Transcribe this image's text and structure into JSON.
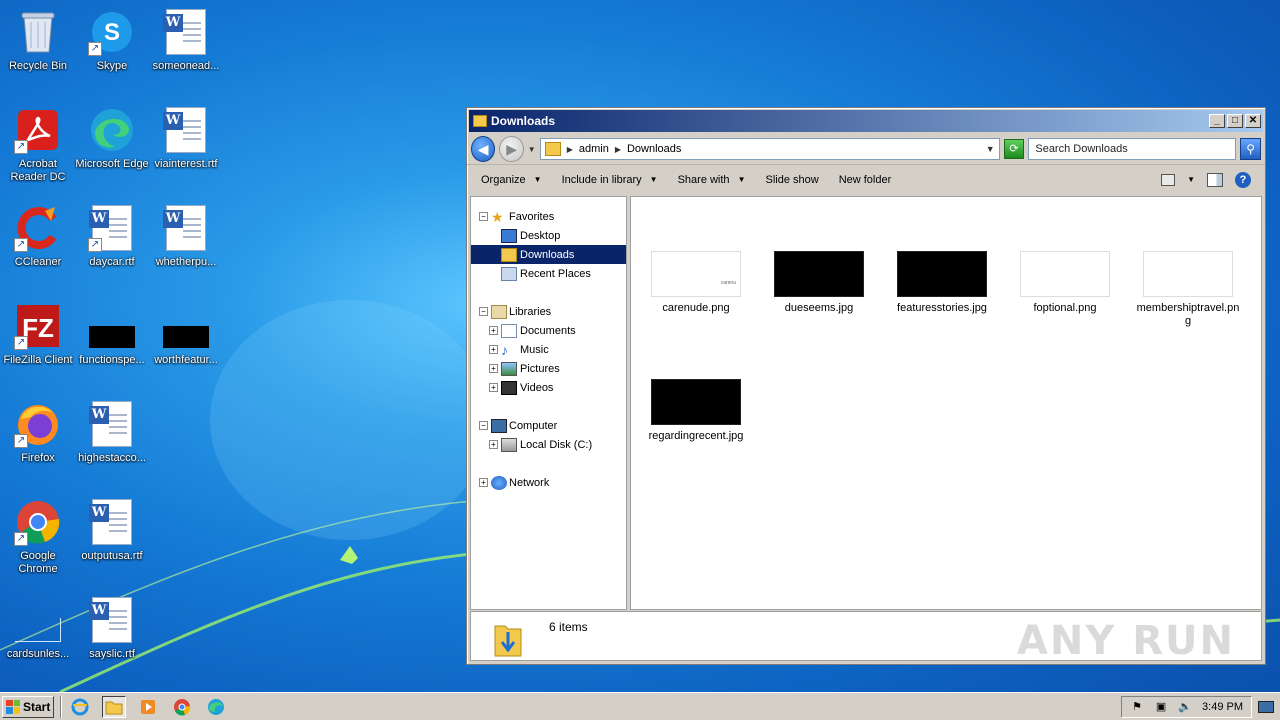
{
  "desktop": {
    "icons": [
      {
        "label": "Recycle Bin",
        "icon": "recycle-bin-icon"
      },
      {
        "label": "Skype",
        "icon": "skype-icon"
      },
      {
        "label": "someonead...",
        "icon": "word-document-icon"
      },
      {
        "label": "Acrobat Reader DC",
        "icon": "acrobat-reader-icon"
      },
      {
        "label": "Microsoft Edge",
        "icon": "edge-icon"
      },
      {
        "label": "viainterest.rtf",
        "icon": "word-document-icon"
      },
      {
        "label": "CCleaner",
        "icon": "ccleaner-icon"
      },
      {
        "label": "daycar.rtf",
        "icon": "word-document-icon"
      },
      {
        "label": "whetherpu...",
        "icon": "word-document-icon"
      },
      {
        "label": "FileZilla Client",
        "icon": "filezilla-icon"
      },
      {
        "label": "functionspe...",
        "icon": "black-image-icon"
      },
      {
        "label": "worthfeatur...",
        "icon": "black-image-icon"
      },
      {
        "label": "Firefox",
        "icon": "firefox-icon"
      },
      {
        "label": "highestacco...",
        "icon": "word-document-icon"
      },
      {
        "label": "Google Chrome",
        "icon": "chrome-icon"
      },
      {
        "label": "outputusa.rtf",
        "icon": "word-document-icon"
      },
      {
        "label": "cardsunles...",
        "icon": "blank-image-icon"
      },
      {
        "label": "sayslic.rtf",
        "icon": "word-document-icon"
      }
    ]
  },
  "window": {
    "title": "Downloads",
    "address": {
      "crumbs": [
        "admin",
        "Downloads"
      ]
    },
    "search_placeholder": "Search Downloads",
    "toolbar": {
      "organize": "Organize",
      "include_in_library": "Include in library",
      "share_with": "Share with",
      "slide_show": "Slide show",
      "new_folder": "New folder"
    },
    "nav": {
      "favorites": "Favorites",
      "desktop": "Desktop",
      "downloads": "Downloads",
      "recent_places": "Recent Places",
      "libraries": "Libraries",
      "documents": "Documents",
      "music": "Music",
      "pictures": "Pictures",
      "videos": "Videos",
      "computer": "Computer",
      "local_disk": "Local Disk (C:)",
      "network": "Network"
    },
    "files": [
      {
        "name": "carenude.png",
        "thumb": "white",
        "mini": "carenu"
      },
      {
        "name": "dueseems.jpg",
        "thumb": "black"
      },
      {
        "name": "featuresstories.jpg",
        "thumb": "black"
      },
      {
        "name": "foptional.png",
        "thumb": "white"
      },
      {
        "name": "membershiptravel.png",
        "thumb": "white"
      },
      {
        "name": "regardingrecent.jpg",
        "thumb": "black"
      }
    ],
    "status": "6 items"
  },
  "watermark": "ANY RUN",
  "taskbar": {
    "start": "Start",
    "clock": "3:49 PM"
  }
}
